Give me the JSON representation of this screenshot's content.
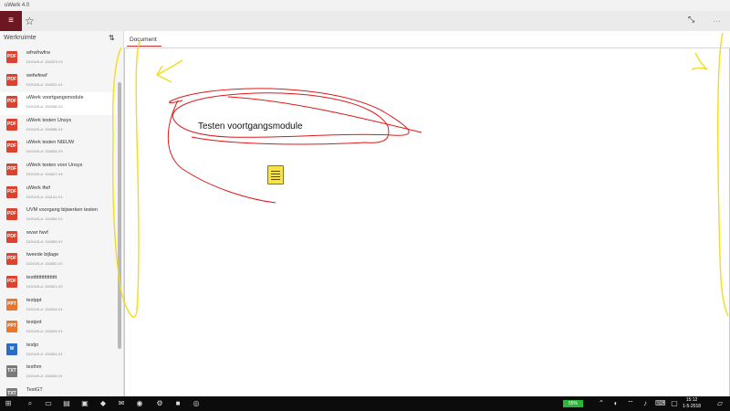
{
  "window": {
    "title": "uWerk 4.0"
  },
  "toolbar": {
    "menu_icon": "hamburger-icon",
    "favorite_icon": "star-icon",
    "fullscreen_icon": "expand-icon",
    "more_icon": "more-icon",
    "accent": "#6d1723"
  },
  "sidebar": {
    "title": "Werkruimte",
    "sort_icon": "sort-icon",
    "items": [
      {
        "name": "wfrwfrwfrw",
        "sub": "DOVUS-#: 1343X3-V1",
        "type": "pdf"
      },
      {
        "name": "wefwfewf",
        "sub": "DOVUS-#: 134331-V1",
        "type": "pdf"
      },
      {
        "name": "uWerk voortgangsmodule",
        "sub": "DOVUS-#: 134336-V2",
        "type": "pdf",
        "active": true
      },
      {
        "name": "uWerk testen Unsys",
        "sub": "DOVUS-#: 134558-V4",
        "type": "pdf"
      },
      {
        "name": "uWerk testen NIEUW",
        "sub": "DOVUS-#: 134554-V3",
        "type": "pdf"
      },
      {
        "name": "uWerk testen voor Unsys",
        "sub": "DOVUS-#: 134527-V4",
        "type": "pdf"
      },
      {
        "name": "uWerk tfwf",
        "sub": "DOVUS-#: 134141-V1",
        "type": "pdf"
      },
      {
        "name": "UVM voorgang bijwerken testen",
        "sub": "DOVUS-#: 134354-V1",
        "type": "pdf"
      },
      {
        "name": "wvwr fwvf",
        "sub": "DOVUS-#: 134359-V1",
        "type": "pdf"
      },
      {
        "name": "tweede bijlage",
        "sub": "DOVUS-#: 134552-V2",
        "type": "pdf"
      },
      {
        "name": "testtttttttttttttttt",
        "sub": "DOVUS-#: 134321-V2",
        "type": "pdf"
      },
      {
        "name": "testppt",
        "sub": "DOVUS-#: 134324-V1",
        "type": "ppt"
      },
      {
        "name": "testpot",
        "sub": "DOVUS-#: 134324-V1",
        "type": "ppt"
      },
      {
        "name": "testjo",
        "sub": "DOVUS-#: 134351-V1",
        "type": "word"
      },
      {
        "name": "testhm",
        "sub": "DOVUS-#: 134349-V1",
        "type": "txt"
      },
      {
        "name": "TestGT",
        "sub": "DOVUS-#: 134334-V1",
        "type": "txt"
      }
    ]
  },
  "main": {
    "tab_label": "Document",
    "annotation_text": "Testen voortgangsmodule",
    "note_icon": "sticky-note-icon"
  },
  "taskbar": {
    "battery": "55%",
    "time": "15:12",
    "date": "1-5-2018"
  }
}
